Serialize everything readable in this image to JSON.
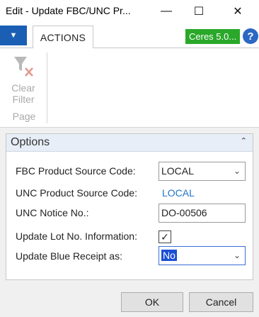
{
  "window": {
    "title": "Edit - Update FBC/UNC Pr...",
    "min_glyph": "—",
    "max_glyph": "☐",
    "close_glyph": "✕"
  },
  "ribbon": {
    "app_menu_glyph": "▼",
    "tab_actions": "ACTIONS",
    "company_badge": "Ceres 5.0...",
    "help_glyph": "?",
    "clear_filter_label_1": "Clear",
    "clear_filter_label_2": "Filter",
    "group_label": "Page"
  },
  "options": {
    "title": "Options",
    "collapse_glyph": "⌃",
    "fields": {
      "fbc_source_code": {
        "label": "FBC Product Source Code:",
        "value": "LOCAL"
      },
      "unc_source_code": {
        "label": "UNC Product Source Code:",
        "value": "LOCAL"
      },
      "unc_notice_no": {
        "label": "UNC Notice No.:",
        "value": "DO-00506"
      },
      "update_lot_no": {
        "label": "Update Lot No. Information:",
        "checked_glyph": "✓"
      },
      "update_blue_receipt": {
        "label": "Update Blue Receipt as:",
        "value": "No"
      }
    },
    "chevron_glyph": "⌄"
  },
  "footer": {
    "ok": "OK",
    "cancel": "Cancel"
  },
  "colors": {
    "accent_blue": "#1a5fb4",
    "company_green": "#29a829",
    "link_blue": "#1f74c8"
  }
}
